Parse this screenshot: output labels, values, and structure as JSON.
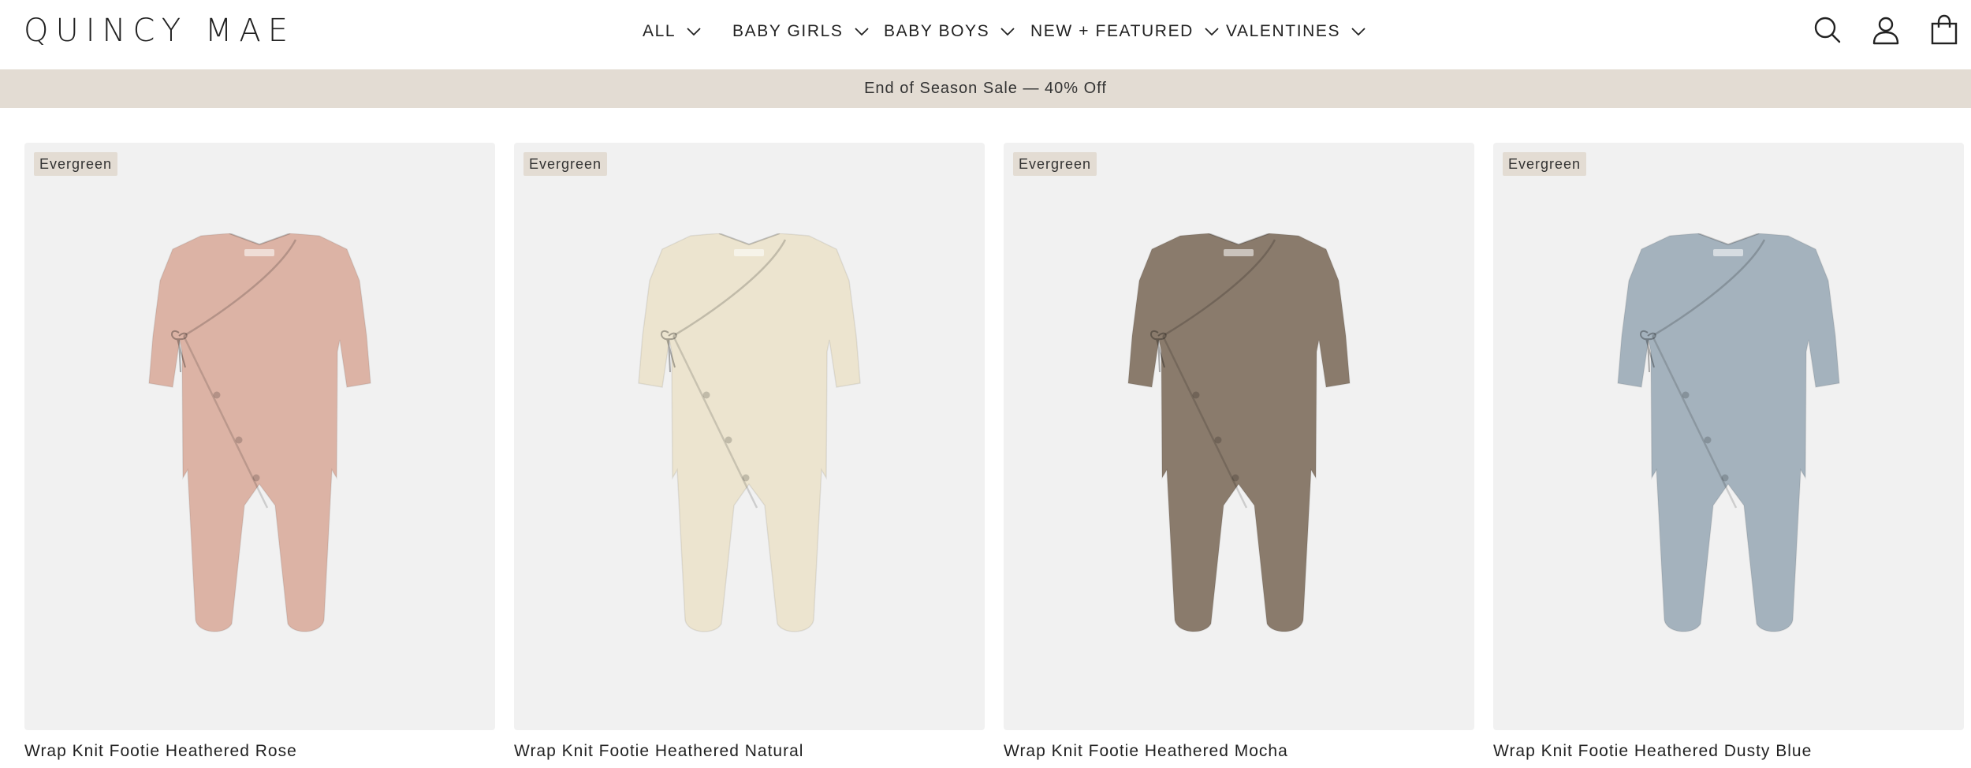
{
  "brand": {
    "logo_text": "QUINCY MAE"
  },
  "nav": {
    "items": [
      {
        "label": "ALL"
      },
      {
        "label": "BABY GIRLS"
      },
      {
        "label": "BABY BOYS"
      },
      {
        "label": "NEW + FEATURED"
      },
      {
        "label": "VALENTINES"
      }
    ]
  },
  "header_icons": [
    "search-icon",
    "account-icon",
    "cart-icon"
  ],
  "banner": {
    "text": "End of Season Sale — 40% Off"
  },
  "products": [
    {
      "badge": "Evergreen",
      "title": "Wrap Knit Footie Heathered Rose",
      "color": "#dcb3a5"
    },
    {
      "badge": "Evergreen",
      "title": "Wrap Knit Footie Heathered Natural",
      "color": "#ece4cf"
    },
    {
      "badge": "Evergreen",
      "title": "Wrap Knit Footie Heathered Mocha",
      "color": "#8a7b6c"
    },
    {
      "badge": "Evergreen",
      "title": "Wrap Knit Footie Heathered Dusty Blue",
      "color": "#a4b2bd"
    }
  ],
  "colors": {
    "banner_bg": "#e3dcd3",
    "tile_bg": "#f1f1f1",
    "text": "#222222"
  }
}
